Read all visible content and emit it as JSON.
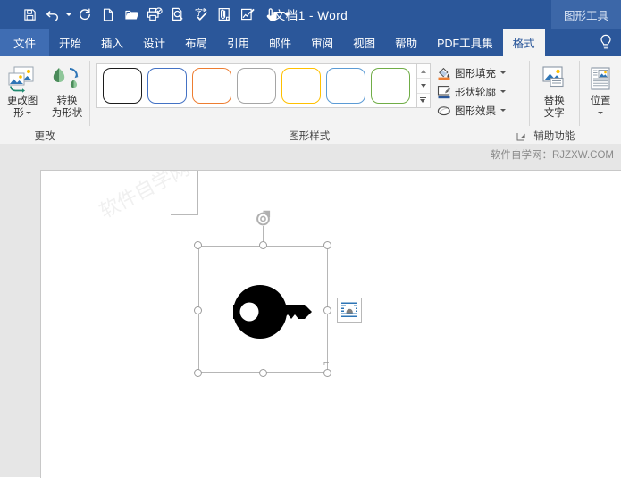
{
  "window": {
    "title": "文档1  -  Word",
    "contextual_tab": "图形工具"
  },
  "quick_access": {
    "items": [
      {
        "name": "save-icon",
        "label": "保存"
      },
      {
        "name": "undo-icon",
        "label": "撤消"
      },
      {
        "name": "redo-icon",
        "label": "恢复"
      },
      {
        "name": "new-document-icon",
        "label": "新建"
      },
      {
        "name": "open-folder-icon",
        "label": "打开"
      },
      {
        "name": "quick-print-icon",
        "label": "快速打印"
      },
      {
        "name": "print-preview-icon",
        "label": "打印预览和打印"
      },
      {
        "name": "spelling-check-icon",
        "label": "拼写和语法"
      },
      {
        "name": "attach-icon",
        "label": "附件"
      },
      {
        "name": "edit-chart-icon",
        "label": "编辑图表"
      },
      {
        "name": "touch-mouse-mode-icon",
        "label": "触摸/鼠标模式"
      }
    ]
  },
  "tabs": [
    {
      "label": "文件",
      "active": false,
      "kind": "file"
    },
    {
      "label": "开始",
      "active": false
    },
    {
      "label": "插入",
      "active": false
    },
    {
      "label": "设计",
      "active": false
    },
    {
      "label": "布局",
      "active": false
    },
    {
      "label": "引用",
      "active": false
    },
    {
      "label": "邮件",
      "active": false
    },
    {
      "label": "审阅",
      "active": false
    },
    {
      "label": "视图",
      "active": false
    },
    {
      "label": "帮助",
      "active": false
    },
    {
      "label": "PDF工具集",
      "active": false
    },
    {
      "label": "格式",
      "active": true
    }
  ],
  "tell_me": {
    "icon": "lightbulb-icon",
    "label": "操作说明搜索"
  },
  "ribbon": {
    "groups": [
      {
        "name": "更改",
        "buttons": [
          {
            "label_line1": "更改图",
            "label_line2": "形",
            "has_dropdown": true,
            "name": "change-graphic-button"
          },
          {
            "label_line1": "转换",
            "label_line2": "为形状",
            "has_dropdown": false,
            "name": "convert-to-shape-button"
          }
        ]
      },
      {
        "name": "图形样式",
        "gallery": {
          "swatches": [
            {
              "border": "#1c1c1c",
              "label": "样式1"
            },
            {
              "border": "#4472c4",
              "label": "样式2"
            },
            {
              "border": "#ed7d31",
              "label": "样式3"
            },
            {
              "border": "#a5a5a5",
              "label": "样式4"
            },
            {
              "border": "#ffc000",
              "label": "样式5"
            },
            {
              "border": "#5b9bd5",
              "label": "样式6"
            },
            {
              "border": "#70ad47",
              "label": "样式7"
            }
          ],
          "scroll": [
            "scroll-up-icon",
            "scroll-down-icon",
            "more-styles-icon"
          ]
        },
        "menus": [
          {
            "label": "图形填充",
            "icon": "paint-bucket-icon",
            "accent": "#ed7d31",
            "has_dropdown": true
          },
          {
            "label": "形状轮廓",
            "icon": "pen-outline-icon",
            "accent": "#2b579a",
            "has_dropdown": true
          },
          {
            "label": "图形效果",
            "icon": "shape-effects-icon",
            "accent": "#707070",
            "has_dropdown": true
          }
        ],
        "dialog_launcher": "dialog-box-launcher"
      },
      {
        "name": "辅助功能",
        "buttons": [
          {
            "label_line1": "替换",
            "label_line2": "文字",
            "has_dropdown": false,
            "name": "alt-text-button"
          }
        ]
      },
      {
        "name": "",
        "buttons": [
          {
            "label_line1": "位置",
            "label_line2": "",
            "has_dropdown": true,
            "name": "position-button"
          }
        ]
      }
    ]
  },
  "document": {
    "watermark": "软件自学网：RJZXW.COM",
    "page_watermark": "软件自学网",
    "end_mark": "⌐",
    "shape": {
      "name": "key-icon",
      "fill": "#000000",
      "selected": true,
      "handles": 8,
      "rotate_handle": "rotate-handle-icon"
    },
    "layout_options": {
      "name": "layout-options-button",
      "tooltip": "布局选项",
      "wrap": "四周型环绕"
    }
  },
  "colors": {
    "title_bar": "#2b579a",
    "ribbon_bg": "#f3f3f3",
    "doc_bg": "#e6e6e6",
    "accent": "#2b579a"
  }
}
